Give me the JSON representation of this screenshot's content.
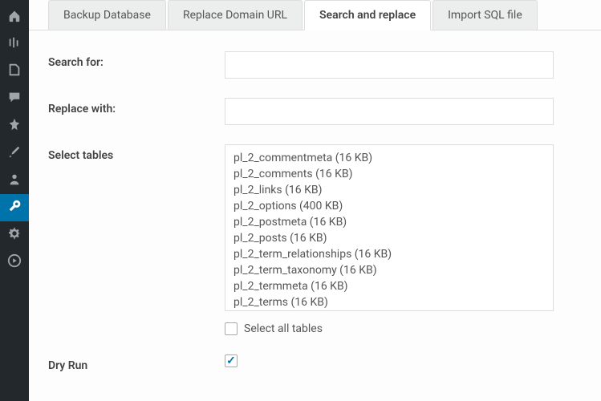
{
  "sidebar": {
    "items": [
      {
        "name": "dashboard",
        "icon": "dashboard"
      },
      {
        "name": "settings",
        "icon": "sliders"
      },
      {
        "name": "pages",
        "icon": "pages"
      },
      {
        "name": "comments",
        "icon": "comment"
      },
      {
        "name": "posts",
        "icon": "pin"
      },
      {
        "name": "appearance",
        "icon": "brush"
      },
      {
        "name": "users",
        "icon": "user"
      },
      {
        "name": "tools",
        "icon": "wrench",
        "active": true
      },
      {
        "name": "general",
        "icon": "gear"
      },
      {
        "name": "media",
        "icon": "play"
      }
    ]
  },
  "tabs": [
    {
      "label": "Backup Database"
    },
    {
      "label": "Replace Domain URL"
    },
    {
      "label": "Search and replace",
      "active": true
    },
    {
      "label": "Import SQL file"
    }
  ],
  "form": {
    "search_label": "Search for:",
    "search_value": "",
    "replace_label": "Replace with:",
    "replace_value": "",
    "tables_label": "Select tables",
    "tables": [
      "pl_2_commentmeta (16 KB)",
      "pl_2_comments (16 KB)",
      "pl_2_links (16 KB)",
      "pl_2_options (400 KB)",
      "pl_2_postmeta (16 KB)",
      "pl_2_posts (16 KB)",
      "pl_2_term_relationships (16 KB)",
      "pl_2_term_taxonomy (16 KB)",
      "pl_2_termmeta (16 KB)",
      "pl_2_terms (16 KB)"
    ],
    "select_all_label": "Select all tables",
    "select_all_checked": false,
    "dryrun_label": "Dry Run",
    "dryrun_checked": true
  }
}
